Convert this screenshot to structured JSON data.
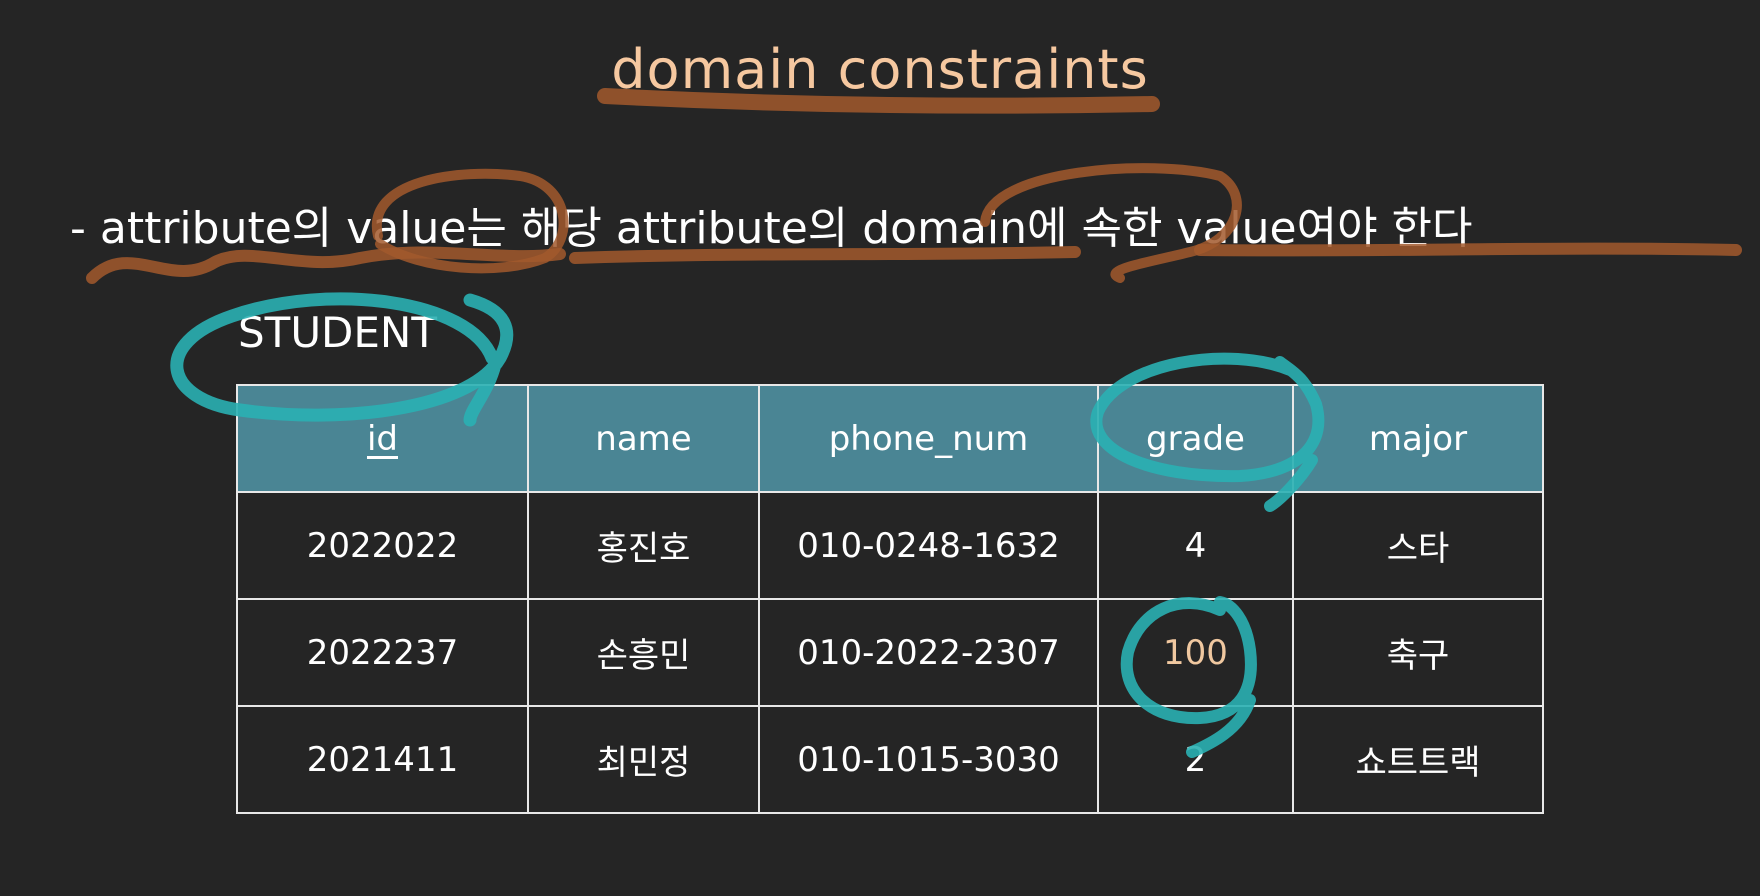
{
  "slide": {
    "title": "domain constraints",
    "bullet": "- attribute의 value는 해당 attribute의 domain에 속한 value여야 한다",
    "table_name": "STUDENT",
    "table": {
      "columns": [
        "id",
        "name",
        "phone_num",
        "grade",
        "major"
      ],
      "rows": [
        [
          "2022022",
          "홍진호",
          "010-0248-1632",
          "4",
          "스타"
        ],
        [
          "2022237",
          "손흥민",
          "010-2022-2307",
          "100",
          "축구"
        ],
        [
          "2021411",
          "최민정",
          "010-1015-3030",
          "2",
          "쇼트트랙"
        ]
      ]
    },
    "colors": {
      "background": "#252525",
      "title": "#f6c8a0",
      "header_fill": "#4a8594",
      "highlight_value": "#f0c8a0",
      "annotation_orange": "#a2592d",
      "annotation_teal": "#2ab0b3"
    }
  }
}
